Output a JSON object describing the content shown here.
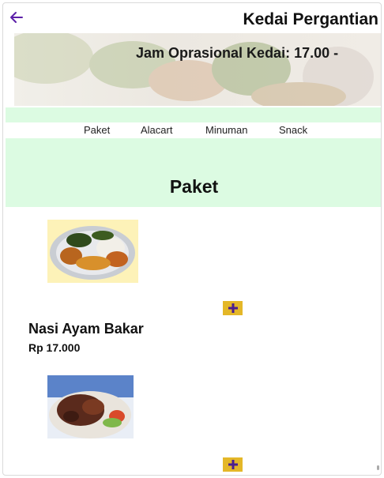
{
  "header": {
    "title": "Kedai Pergantian",
    "back_icon": "arrow-left-icon",
    "accent": "#5b1fa8"
  },
  "banner": {
    "text": "Jam Oprasional Kedai: 17.00 -"
  },
  "tabs": [
    {
      "label": "Paket"
    },
    {
      "label": "Alacart"
    },
    {
      "label": "Minuman"
    },
    {
      "label": "Snack"
    }
  ],
  "section": {
    "title": "Paket"
  },
  "items": [
    {
      "name": "Nasi Ayam Bakar",
      "price": "Rp 17.000",
      "image": "ayam-bakar-plate",
      "add_icon": "plus-icon"
    },
    {
      "name": "",
      "price": "",
      "image": "meat-plate",
      "add_icon": "plus-icon"
    }
  ],
  "colors": {
    "mint": "#dcfbe2",
    "add_button": "#e4b728",
    "plus": "#4b1e8f"
  }
}
